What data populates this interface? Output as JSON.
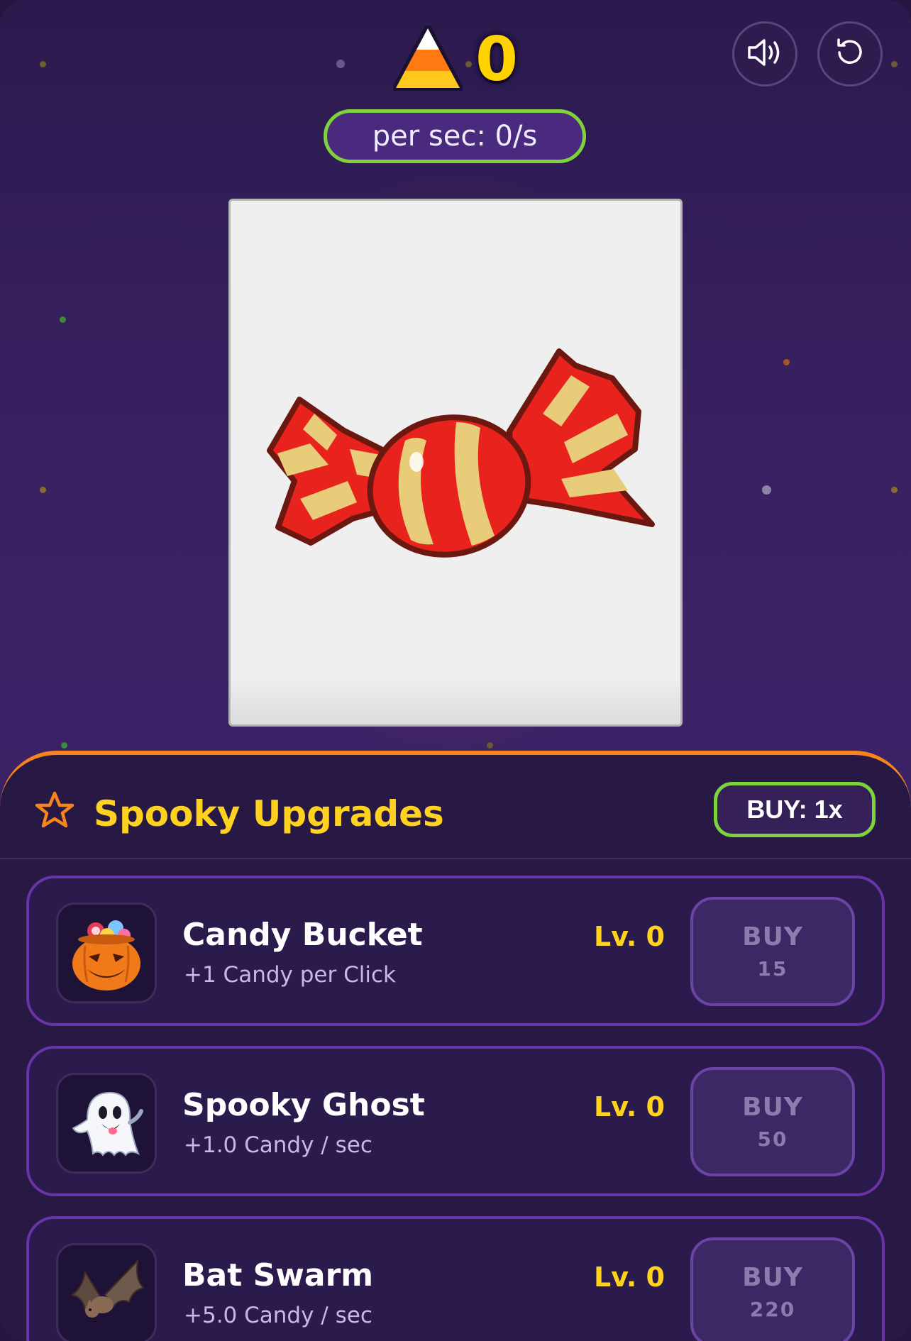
{
  "header": {
    "score": "0",
    "per_sec": "per sec: 0/s",
    "currency_icon": "candy-corn-icon",
    "sound_icon": "speaker-icon",
    "reset_icon": "reset-icon"
  },
  "colors": {
    "accent_yellow": "#ffd21f",
    "accent_green": "#7ed23c",
    "accent_orange": "#f7841c",
    "background": "#2b1a4e"
  },
  "upgrades_panel": {
    "title": "Spooky Upgrades",
    "title_icon": "star-icon",
    "buy_multiplier": "BUY: 1x",
    "items": [
      {
        "name": "Candy Bucket",
        "desc": "+1 Candy per Click",
        "level": "Lv. 0",
        "buy_label": "BUY",
        "cost": "15",
        "icon": "pumpkin-bucket-icon"
      },
      {
        "name": "Spooky Ghost",
        "desc": "+1.0 Candy / sec",
        "level": "Lv. 0",
        "buy_label": "BUY",
        "cost": "50",
        "icon": "ghost-icon"
      },
      {
        "name": "Bat Swarm",
        "desc": "+5.0 Candy / sec",
        "level": "Lv. 0",
        "buy_label": "BUY",
        "cost": "220",
        "icon": "bat-icon"
      }
    ]
  }
}
